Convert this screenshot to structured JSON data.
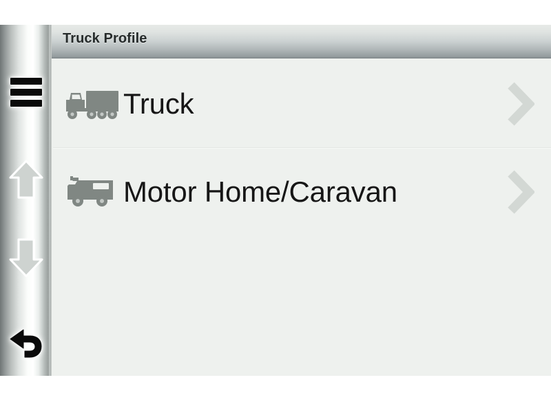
{
  "screen": {
    "title": "Truck Profile"
  },
  "sidebar": {
    "buttons": [
      {
        "name": "menu-icon",
        "label": "Menu"
      },
      {
        "name": "scroll-up-icon",
        "label": "Scroll Up"
      },
      {
        "name": "scroll-down-icon",
        "label": "Scroll Down"
      },
      {
        "name": "back-icon",
        "label": "Back"
      }
    ]
  },
  "list": {
    "items": [
      {
        "label": "Truck",
        "icon": "semi-truck-icon"
      },
      {
        "label": "Motor Home/Caravan",
        "icon": "motor-home-icon"
      }
    ]
  },
  "colors": {
    "screen_background": "#eef1ee",
    "title_text": "#262b2b",
    "list_text": "#161616",
    "vehicle_icon": "#808783",
    "chevron": "#d3d8d4",
    "active_icon": "#0a0a0a",
    "inactive_icon": "#cfd4d1"
  }
}
